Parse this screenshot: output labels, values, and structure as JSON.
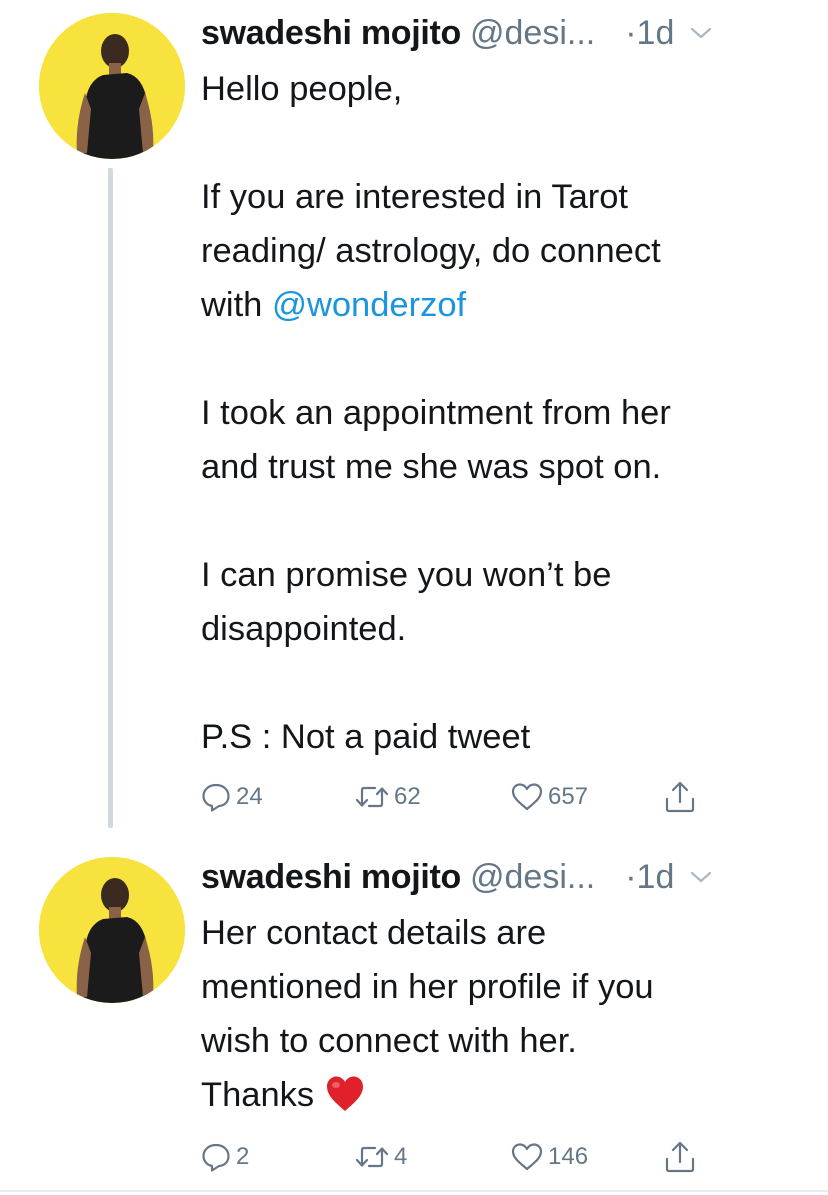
{
  "thread": [
    {
      "author": {
        "name": "swadeshi mojito",
        "handle": "@desi...",
        "time": "·1d"
      },
      "body": {
        "line1": "Hello people,",
        "line2a": "If you are interested in Tarot",
        "line2b": "reading/ astrology, do connect",
        "line2c_prefix": "with ",
        "mention": "@wonderzof",
        "line3a": "I took an appointment from her",
        "line3b": "and trust me she was spot on.",
        "line4a": "I can promise you won’t be",
        "line4b": "disappointed.",
        "line5": "P.S : Not a paid tweet"
      },
      "stats": {
        "replies": "24",
        "retweets": "62",
        "likes": "657"
      }
    },
    {
      "author": {
        "name": "swadeshi mojito",
        "handle": "@desi...",
        "time": "·1d"
      },
      "body": {
        "line1": "Her contact details are",
        "line2": "mentioned in her profile if you",
        "line3": "wish to connect with her.",
        "line4": "Thanks"
      },
      "stats": {
        "replies": "2",
        "retweets": "4",
        "likes": "146"
      }
    }
  ],
  "icons": {
    "reply": "reply-icon",
    "retweet": "retweet-icon",
    "like": "heart-outline-icon",
    "share": "share-icon",
    "emoji": "red-heart-emoji",
    "more": "chevron-down-icon"
  },
  "colors": {
    "avatar_bg": "#f7e23e",
    "mention": "#1b95e0",
    "muted": "#657786",
    "thread_line": "#cfd9de",
    "emoji_heart": "#e0202b"
  }
}
